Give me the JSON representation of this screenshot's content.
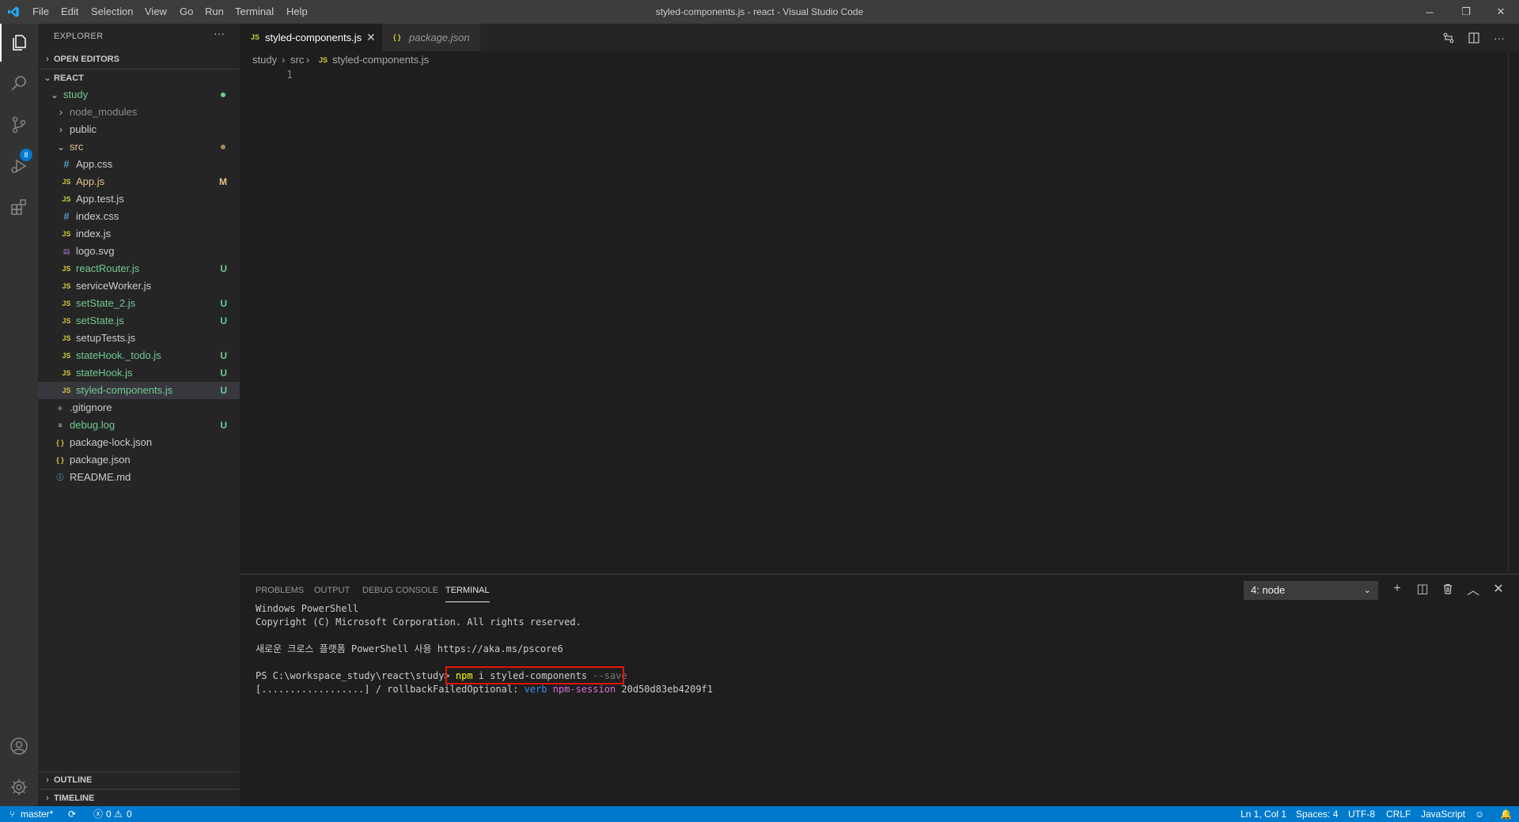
{
  "titlebar": {
    "menu": [
      "File",
      "Edit",
      "Selection",
      "View",
      "Go",
      "Run",
      "Terminal",
      "Help"
    ],
    "window_title": "styled-components.js - react - Visual Studio Code",
    "controls": {
      "minimize": "─",
      "restore": "❐",
      "close": "✕"
    }
  },
  "activitybar": {
    "scm_badge": "8"
  },
  "sidebar": {
    "title": "EXPLORER",
    "more": "···",
    "open_editors": "OPEN EDITORS",
    "root": "REACT",
    "outline": "OUTLINE",
    "timeline": "TIMELINE",
    "tree": [
      {
        "name": "study",
        "kind": "folder-open",
        "status": "dot-green"
      },
      {
        "name": "node_modules",
        "kind": "folder",
        "status": ""
      },
      {
        "name": "public",
        "kind": "folder",
        "status": ""
      },
      {
        "name": "src",
        "kind": "folder-open",
        "status": "dot-yellow"
      },
      {
        "name": "App.css",
        "kind": "css",
        "status": ""
      },
      {
        "name": "App.js",
        "kind": "js",
        "status": "M"
      },
      {
        "name": "App.test.js",
        "kind": "js",
        "status": ""
      },
      {
        "name": "index.css",
        "kind": "css",
        "status": ""
      },
      {
        "name": "index.js",
        "kind": "js",
        "status": ""
      },
      {
        "name": "logo.svg",
        "kind": "svg",
        "status": ""
      },
      {
        "name": "reactRouter.js",
        "kind": "js",
        "status": "U"
      },
      {
        "name": "serviceWorker.js",
        "kind": "js",
        "status": ""
      },
      {
        "name": "setState_2.js",
        "kind": "js",
        "status": "U"
      },
      {
        "name": "setState.js",
        "kind": "js",
        "status": "U"
      },
      {
        "name": "setupTests.js",
        "kind": "js",
        "status": ""
      },
      {
        "name": "stateHook._todo.js",
        "kind": "js",
        "status": "U"
      },
      {
        "name": "stateHook.js",
        "kind": "js",
        "status": "U"
      },
      {
        "name": "styled-components.js",
        "kind": "js",
        "status": "U"
      },
      {
        "name": ".gitignore",
        "kind": "git",
        "status": ""
      },
      {
        "name": "debug.log",
        "kind": "log",
        "status": "U"
      },
      {
        "name": "package-lock.json",
        "kind": "json",
        "status": ""
      },
      {
        "name": "package.json",
        "kind": "json",
        "status": ""
      },
      {
        "name": "README.md",
        "kind": "info",
        "status": ""
      }
    ],
    "icon_glyphs": {
      "js": "JS",
      "css": "#",
      "json": "{ }",
      "svg": "▤",
      "info": "ⓘ",
      "git": "◈",
      "log": "≡"
    }
  },
  "editor": {
    "tabs": [
      {
        "icon": "JS",
        "label": "styled-components.js",
        "close": "✕"
      },
      {
        "icon": "{ }",
        "label": "package.json"
      }
    ],
    "breadcrumb": {
      "part1": "study",
      "part2": "src",
      "icon": "JS",
      "part3": "styled-components.js",
      "sep": "›"
    },
    "line_number": "1"
  },
  "panel": {
    "tabs": [
      "PROBLEMS",
      "OUTPUT",
      "DEBUG CONSOLE",
      "TERMINAL"
    ],
    "terminal_select": "4: node",
    "select_chevron": "⌄",
    "actions": {
      "add": "+",
      "split": "◫",
      "trash": "🗑",
      "maximize": "︿",
      "close": "✕"
    },
    "terminal": {
      "line1": "Windows PowerShell",
      "line2": "Copyright (C) Microsoft Corporation. All rights reserved.",
      "line3": "새로운 크로스 플랫폼 PowerShell 사용 https://aka.ms/pscore6",
      "prompt": "PS C:\\workspace_study\\react\\study> ",
      "cmd_npm": "npm",
      "cmd_rest": " i styled-components ",
      "cmd_flag": "--save",
      "progress_bar": "[..................]",
      "progress_text": " / rollbackFailedOptional: ",
      "progress_verb": "verb",
      "progress_session": " npm-session",
      "progress_id": " 20d50d83eb4209f1"
    }
  },
  "statusbar": {
    "branch": "master*",
    "sync": "⟳",
    "errors": "0",
    "warnings": "0",
    "position": "Ln 1, Col 1",
    "spaces": "Spaces: 4",
    "encoding": "UTF-8",
    "eol": "CRLF",
    "language": "JavaScript"
  },
  "colors": {
    "accent": "#007acc",
    "untracked": "#73c991",
    "modified": "#e2c08d",
    "highlight_box": "#e51400"
  }
}
